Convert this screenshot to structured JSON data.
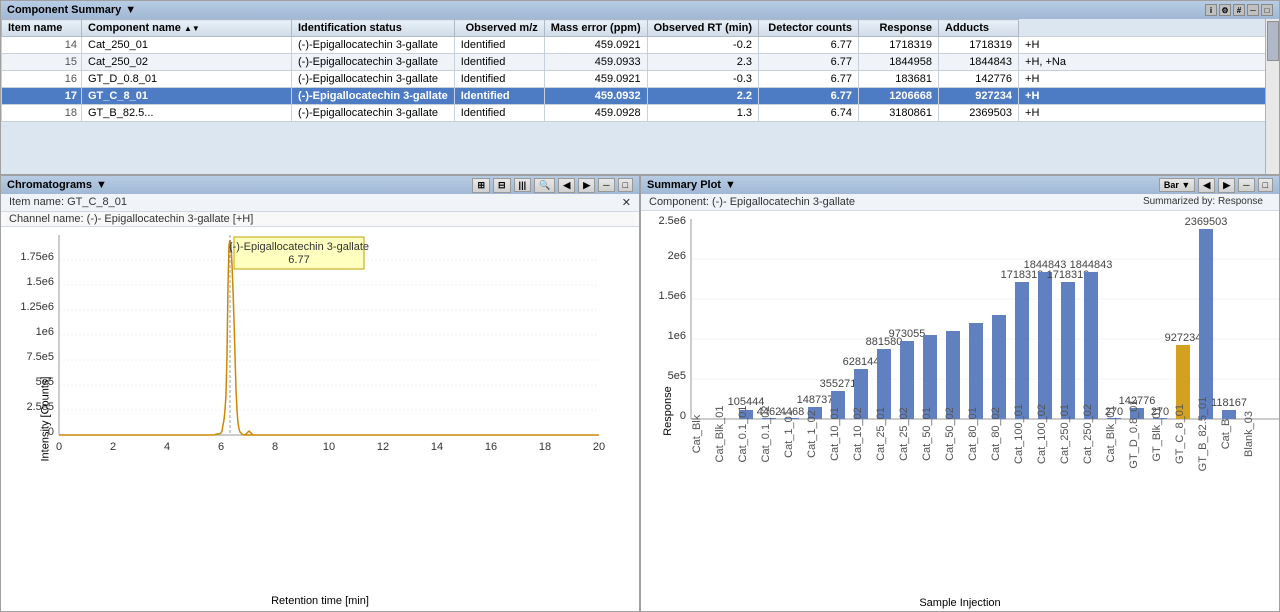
{
  "app": {
    "title": "Component Summary"
  },
  "table": {
    "columns": [
      "Item name",
      "Component name",
      "Identification status",
      "Observed m/z",
      "Mass error (ppm)",
      "Observed RT (min)",
      "Detector counts",
      "Response",
      "Adducts"
    ],
    "rows": [
      {
        "num": 14,
        "item_name": "Cat_250_01",
        "component_name": "(-)-Epigallocatechin 3-gallate",
        "id_status": "Identified",
        "mz": "459.0921",
        "mass_error": "-0.2",
        "rt": "6.77",
        "detector_counts": "1718319",
        "response": "1718319",
        "adducts": "+H",
        "selected": false
      },
      {
        "num": 15,
        "item_name": "Cat_250_02",
        "component_name": "(-)-Epigallocatechin 3-gallate",
        "id_status": "Identified",
        "mz": "459.0933",
        "mass_error": "2.3",
        "rt": "6.77",
        "detector_counts": "1844958",
        "response": "1844843",
        "adducts": "+H, +Na",
        "selected": false
      },
      {
        "num": 16,
        "item_name": "GT_D_0.8_01",
        "component_name": "(-)-Epigallocatechin 3-gallate",
        "id_status": "Identified",
        "mz": "459.0921",
        "mass_error": "-0.3",
        "rt": "6.77",
        "detector_counts": "183681",
        "response": "142776",
        "adducts": "+H",
        "selected": false
      },
      {
        "num": 17,
        "item_name": "GT_C_8_01",
        "component_name": "(-)-Epigallocatechin 3-gallate",
        "id_status": "Identified",
        "mz": "459.0932",
        "mass_error": "2.2",
        "rt": "6.77",
        "detector_counts": "1206668",
        "response": "927234",
        "adducts": "+H",
        "selected": true
      },
      {
        "num": 18,
        "item_name": "GT_B_82.5...",
        "component_name": "(-)-Epigallocatechin 3-gallate",
        "id_status": "Identified",
        "mz": "459.0928",
        "mass_error": "1.3",
        "rt": "6.74",
        "detector_counts": "3180861",
        "response": "2369503",
        "adducts": "+H",
        "selected": false
      }
    ]
  },
  "chromatogram": {
    "panel_title": "Chromatograms",
    "item_name": "Item name: GT_C_8_01",
    "channel_name": "Channel name: (-)- Epigallocatechin 3-gallate [+H]",
    "tooltip_compound": "(-)-Epigallocatechin 3-gallate",
    "tooltip_rt": "6.77",
    "x_label": "Retention time [min]",
    "y_label": "Intensity [Counts]",
    "x_ticks": [
      "0",
      "2",
      "4",
      "6",
      "8",
      "10",
      "12",
      "14",
      "16",
      "18",
      "20"
    ],
    "y_ticks": [
      "0",
      "2.5e5",
      "5e5",
      "7.5e5",
      "1e6",
      "1.25e6",
      "1.5e6",
      "1.75e6"
    ],
    "y_tick_labels": [
      "0",
      "2.5e5",
      "5e5",
      "7.5e5",
      "1e6",
      "1.25e6",
      "1.5e6",
      "1.75e6"
    ]
  },
  "summary_plot": {
    "panel_title": "Summary Plot",
    "component": "Component: (-)- Epigallocatechin 3-gallate",
    "summarized_by": "Summarized by: Response",
    "x_label": "Sample Injection",
    "y_label": "Response",
    "bar_type": "Bar",
    "bars": [
      {
        "label": "Cat_Blk",
        "value": 0,
        "highlighted": false
      },
      {
        "label": "Cat_Blk_01",
        "value": 0,
        "highlighted": false
      },
      {
        "label": "Cat_0.1_01",
        "value": 105444,
        "highlighted": false
      },
      {
        "label": "Cat_0.1_02",
        "value": 4462,
        "highlighted": false
      },
      {
        "label": "Cat_1_01",
        "value": 4468,
        "highlighted": false
      },
      {
        "label": "Cat_1_02",
        "value": 148737,
        "highlighted": false
      },
      {
        "label": "Cat_10_01",
        "value": 355271,
        "highlighted": false
      },
      {
        "label": "Cat_10_02",
        "value": 628144,
        "highlighted": false
      },
      {
        "label": "Cat_25_01",
        "value": 881580,
        "highlighted": false
      },
      {
        "label": "Cat_25_02",
        "value": 973055,
        "highlighted": false
      },
      {
        "label": "Cat_50_01",
        "value": 1050000,
        "highlighted": false
      },
      {
        "label": "Cat_50_02",
        "value": 1100000,
        "highlighted": false
      },
      {
        "label": "Cat_80_01",
        "value": 1200000,
        "highlighted": false
      },
      {
        "label": "Cat_80_02",
        "value": 1300000,
        "highlighted": false
      },
      {
        "label": "Cat_100_01",
        "value": 1718319,
        "highlighted": false
      },
      {
        "label": "Cat_100_02",
        "value": 1844843,
        "highlighted": false
      },
      {
        "label": "Cat_250_01",
        "value": 1718319,
        "highlighted": false
      },
      {
        "label": "Cat_250_02",
        "value": 1844843,
        "highlighted": false
      },
      {
        "label": "Cat_Blk_01",
        "value": 270,
        "highlighted": false
      },
      {
        "label": "GT_D_0.8_01",
        "value": 142776,
        "highlighted": false
      },
      {
        "label": "GT_Blk_01",
        "value": 270,
        "highlighted": false
      },
      {
        "label": "GT_C_8_01",
        "value": 927234,
        "highlighted": true
      },
      {
        "label": "GT_B_82.5_01",
        "value": 2369503,
        "highlighted": false
      },
      {
        "label": "Cat_B",
        "value": 118167,
        "highlighted": false
      },
      {
        "label": "Blank_03",
        "value": 0,
        "highlighted": false
      }
    ]
  }
}
